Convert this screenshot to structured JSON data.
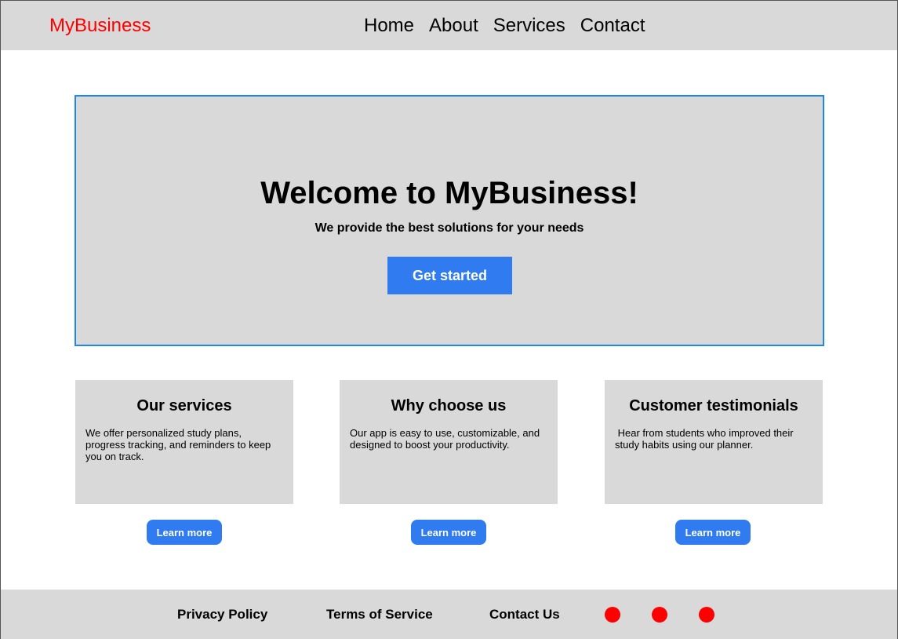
{
  "header": {
    "logo": "MyBusiness",
    "nav": [
      "Home",
      "About",
      "Services",
      "Contact"
    ]
  },
  "hero": {
    "title": "Welcome to MyBusiness!",
    "subtitle": "We provide the best solutions for your needs",
    "cta_label": "Get started"
  },
  "cards": [
    {
      "title": "Our services",
      "text": "We offer personalized study plans, progress tracking, and reminders to keep you on track.",
      "button_label": "Learn more"
    },
    {
      "title": "Why choose us",
      "text": "Our app is easy to use, customizable, and designed to boost your productivity.",
      "button_label": "Learn more"
    },
    {
      "title": "Customer testimonials",
      "text": " Hear from students who improved their study habits using our planner.",
      "button_label": "Learn more"
    }
  ],
  "footer": {
    "links": [
      "Privacy Policy",
      "Terms of Service",
      "Contact Us"
    ],
    "social_icons": [
      "social-icon",
      "social-icon",
      "social-icon"
    ]
  },
  "colors": {
    "logo": "#ff0000",
    "primary_button": "#2f7bef",
    "hero_border": "#1e88e5",
    "panel_bg": "#d9d9d9",
    "social_dot": "#ff0000"
  }
}
